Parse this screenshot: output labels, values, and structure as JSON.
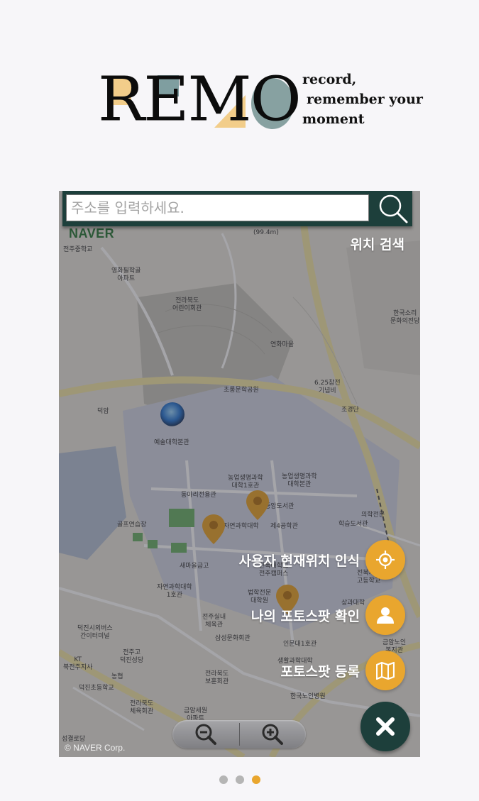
{
  "logo": {
    "word": "REMO",
    "tagline": [
      "record,",
      "remember your",
      "moment"
    ]
  },
  "map": {
    "search": {
      "placeholder": "주소를 입력하세요.",
      "button_icon": "search-icon",
      "caption": "위치 검색"
    },
    "brand": "NAVER",
    "copyright": "© NAVER Corp.",
    "scale_text": "(99.4m)",
    "place_labels": [
      "전주중학교",
      "영화필학골\n아파트",
      "전라북도\n어린이회관",
      "연화마을",
      "한국소리\n문화의전당",
      "6.25참전\n기념비",
      "초롱문학공원",
      "덕암",
      "조경단",
      "예술대학본관",
      "농업생명과학\n대학1호관",
      "농업생명과학\n대학본관",
      "중앙도서관",
      "동아리전용관",
      "제4공학관",
      "학습도서관",
      "골프연습장",
      "자연과학대학",
      "새마을금고",
      "전북대학교\n전주캠퍼스",
      "자연과학대학\n1호관",
      "법학전문\n대학원",
      "전주실내\n체육관",
      "삼성문화회관",
      "인문대1호관",
      "덕진시외버스\n간이터미널",
      "전주고\n덕진성당",
      "KT\n북전주지사",
      "농협",
      "덕진초등학교",
      "전라북도\n보훈회관",
      "생활과학대학",
      "한국노인병원",
      "전라북도\n체육회관",
      "금암세원\n아파트",
      "성결로당",
      "전북지역\n고등학교",
      "금암노인\n복지관",
      "의학전문",
      "상과대학"
    ],
    "actions": [
      {
        "label": "사용자 현재위치 인식",
        "icon": "crosshair-icon"
      },
      {
        "label": "나의 포토스팟 확인",
        "icon": "user-icon"
      },
      {
        "label": "포토스팟 등록",
        "icon": "map-icon"
      }
    ],
    "close_icon": "close-icon",
    "zoom": {
      "out_icon": "zoom-out-icon",
      "in_icon": "zoom-in-icon"
    }
  },
  "pagination": {
    "total": 3,
    "active": 3
  },
  "colors": {
    "accent": "#e9a62e",
    "dark_green": "#1d3f3b",
    "logo_yellow": "#f2cd8a",
    "logo_teal": "#87a1a1"
  }
}
